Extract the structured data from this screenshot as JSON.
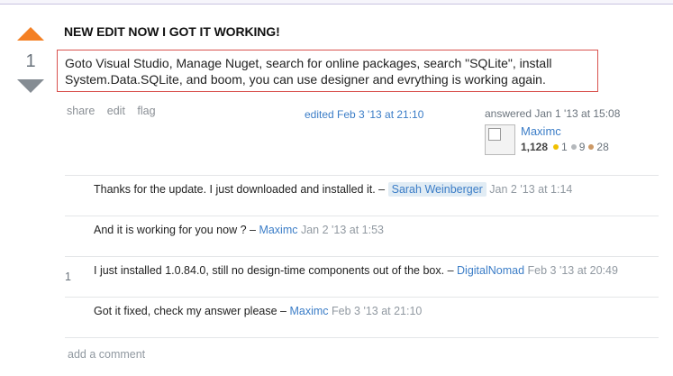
{
  "vote": {
    "count": "1"
  },
  "post": {
    "title": "NEW EDIT NOW I GOT IT WORKING!",
    "line1": "Goto Visual Studio, Manage Nuget, search for online packages, search \"SQLite\", install",
    "line2": "System.Data.SQLite, and boom, you can use designer and evrything is working again."
  },
  "menu": {
    "share": "share",
    "edit": "edit",
    "flag": "flag"
  },
  "edited": "edited Feb 3 '13 at 21:10",
  "owner": {
    "answered": "answered Jan 1 '13 at 15:08",
    "name": "Maximc",
    "rep": "1,128",
    "gold": "1",
    "silver": "9",
    "bronze": "28"
  },
  "comments": [
    {
      "score": "",
      "text": "Thanks for the update. I just downloaded and installed it. – ",
      "user": "Sarah Weinberger",
      "date": " Jan 2 '13 at 1:14"
    },
    {
      "score": "",
      "text": "And it is working for you now ? – ",
      "user": "Maximc",
      "date": " Jan 2 '13 at 1:53"
    },
    {
      "score": "1",
      "text": "I just installed 1.0.84.0, still no design-time components out of the box. – ",
      "user": "DigitalNomad",
      "date": " Feb 3 '13 at 20:49"
    },
    {
      "score": "",
      "text": "Got it fixed, check my answer please – ",
      "user": "Maximc",
      "date": " Feb 3 '13 at 21:10"
    }
  ],
  "add_comment": "add a comment",
  "colors": {
    "upvote": "#f48024",
    "downvote": "#858c93",
    "link": "#3b7dc7",
    "highlight_border": "#d9534f"
  }
}
